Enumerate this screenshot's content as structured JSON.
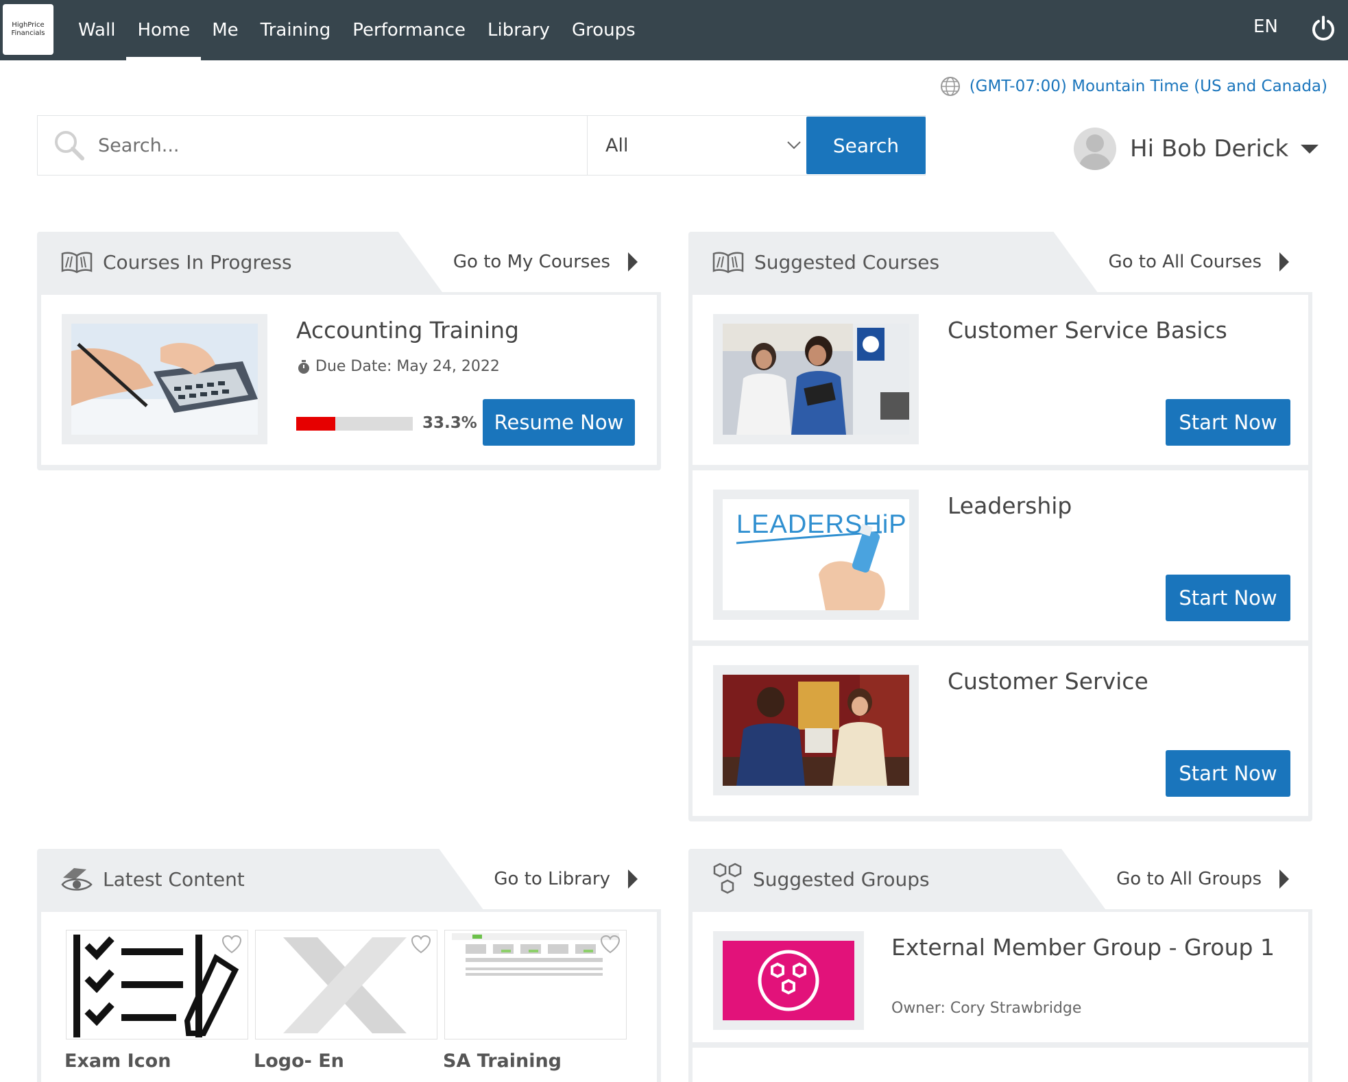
{
  "app": {
    "logo_text": "HighPrice\nFinancials",
    "nav": [
      {
        "label": "Wall"
      },
      {
        "label": "Home",
        "active": true
      },
      {
        "label": "Me"
      },
      {
        "label": "Training"
      },
      {
        "label": "Performance"
      },
      {
        "label": "Library"
      },
      {
        "label": "Groups"
      }
    ],
    "language": "EN",
    "power_icon": "power-icon",
    "timezone": "(GMT-07:00) Mountain Time (US and Canada)",
    "accent_color": "#1a75bc",
    "header_color": "#37454d"
  },
  "search": {
    "placeholder": "Search...",
    "filter_value": "All",
    "button_label": "Search"
  },
  "user": {
    "greeting": "Hi Bob Derick"
  },
  "courses_in_progress": {
    "title": "Courses In Progress",
    "link": "Go to My Courses",
    "items": [
      {
        "title": "Accounting Training",
        "due": "Due Date: May 24, 2022",
        "progress_label": "33.3%",
        "progress": 0.333,
        "button": "Resume Now"
      }
    ]
  },
  "suggested_courses": {
    "title": "Suggested Courses",
    "link": "Go to All Courses",
    "items": [
      {
        "title": "Customer Service Basics",
        "button": "Start Now"
      },
      {
        "title": "Leadership",
        "button": "Start Now",
        "thumb_text": "LEADERSHiP"
      },
      {
        "title": "Customer Service",
        "button": "Start Now"
      }
    ]
  },
  "latest_content": {
    "title": "Latest Content",
    "link": "Go to Library",
    "items": [
      {
        "label": "Exam Icon"
      },
      {
        "label": "Logo- En"
      },
      {
        "label": "SA Training"
      }
    ]
  },
  "suggested_groups": {
    "title": "Suggested Groups",
    "link": "Go to All Groups",
    "items": [
      {
        "title": "External Member Group - Group 1",
        "owner": "Owner: Cory Strawbridge"
      }
    ]
  }
}
